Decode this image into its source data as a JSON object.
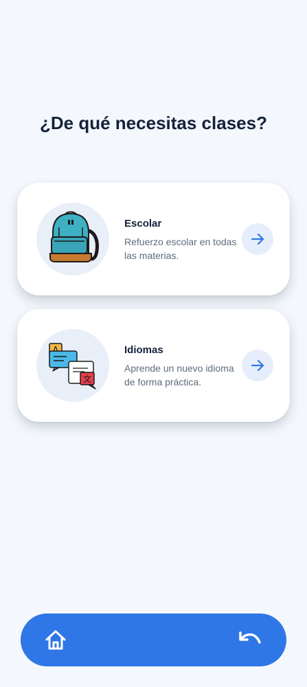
{
  "page": {
    "title": "¿De qué necesitas clases?"
  },
  "options": [
    {
      "title": "Escolar",
      "description": "Refuerzo escolar en todas las materias.",
      "icon": "backpack-icon"
    },
    {
      "title": "Idiomas",
      "description": "Aprende un nuevo idioma de forma práctica.",
      "icon": "translate-icon",
      "icon_letters": [
        "A",
        "文"
      ]
    }
  ],
  "nav": {
    "home_icon": "home-icon",
    "back_icon": "undo-arrow-icon"
  },
  "colors": {
    "background": "#f4f8fd",
    "accent": "#2f77e6",
    "title_text": "#14223a",
    "muted_text": "#5f6b7e",
    "icon_circle": "#e9eff9",
    "arrow_button_bg": "#e6eefb",
    "backpack": "#3fb0c4",
    "backpack_bottom": "#c77a2f",
    "bubble_orange": "#f4b548",
    "bubble_blue": "#4bb8e8",
    "bubble_red": "#e2404a"
  }
}
